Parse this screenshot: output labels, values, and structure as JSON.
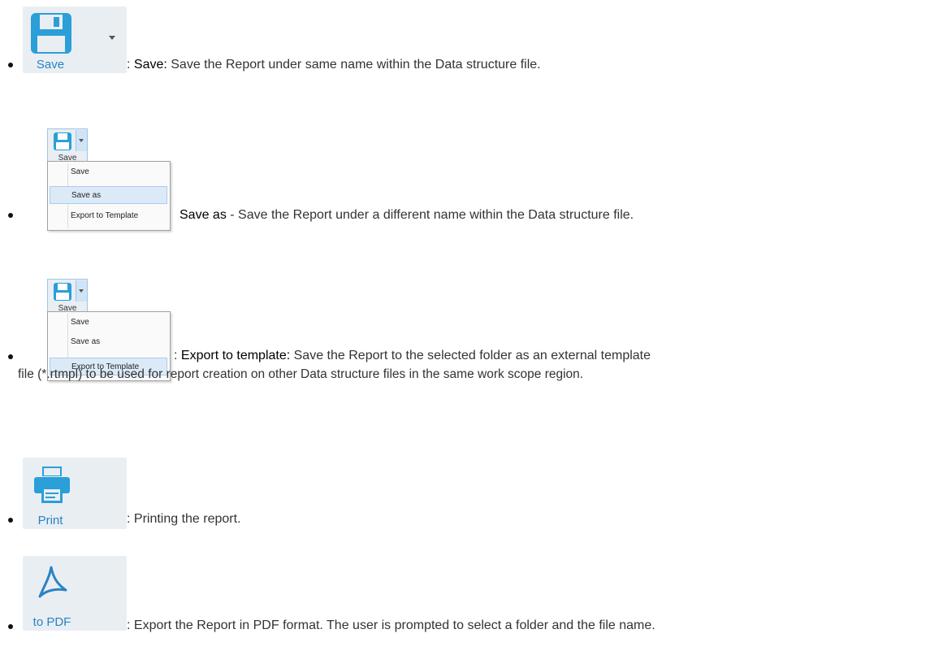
{
  "items": [
    {
      "icon_label": "Save",
      "term": "Save:",
      "description": " Save the Report under same name within the Data structure file.",
      "prefix": ": "
    },
    {
      "menu_caption": "Save",
      "menu_items": [
        "Save",
        "Save as",
        "Export to Template"
      ],
      "selected_index": 1,
      "term": "Save as",
      "description": " - Save the Report under a different name within the Data structure file."
    },
    {
      "menu_caption": "Save",
      "menu_items": [
        "Save",
        "Save as",
        "Export to Template"
      ],
      "selected_index": 2,
      "prefix": ": ",
      "term": "Export to template:",
      "description_line1": " Save the Report to the selected folder as an external template",
      "description_line2": "file (*.rtmpl) to be used for report creation on other Data structure files in the same work scope region."
    },
    {
      "icon_label": "Print",
      "prefix": ": ",
      "description": "Printing the report."
    },
    {
      "icon_label": "to PDF",
      "prefix": ": ",
      "description": "Export the Report in PDF format. The user is prompted to select a folder and the file name."
    }
  ],
  "colors": {
    "accent": "#2a83c4",
    "button_bg": "#e9eef3",
    "highlight": "#dceaf8"
  }
}
